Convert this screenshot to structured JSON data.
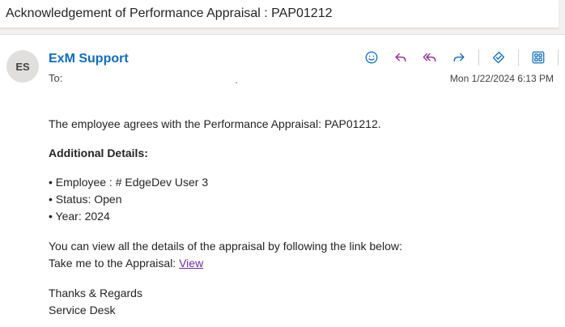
{
  "subject": "Acknowledgement of Performance Appraisal : PAP01212",
  "sender": {
    "initials": "ES",
    "name": "ExM Support",
    "to_label": "To:",
    "recipient": "."
  },
  "timestamp": "Mon 1/22/2024 6:13 PM",
  "actions": {
    "emoji": "emoji-icon",
    "reply": "reply-icon",
    "reply_all": "reply-all-icon",
    "forward": "forward-icon",
    "tag": "tag-icon",
    "apps": "apps-icon",
    "more": "…"
  },
  "colors": {
    "accent": "#0f6cbd",
    "reply_icon": "#8a2a8a",
    "link_visited": "#6b2fa0"
  },
  "body": {
    "intro": "The employee agrees with the Performance Appraisal: PAP01212.",
    "details_heading": "Additional Details:",
    "details": [
      "• Employee : # EdgeDev User 3",
      "• Status: Open",
      "• Year: 2024"
    ],
    "view_text": "You can view all the details of the appraisal by following the link below:",
    "link_prefix": "Take me to the Appraisal: ",
    "link_label": "View",
    "closing": "Thanks & Regards",
    "signature": "Service Desk"
  }
}
